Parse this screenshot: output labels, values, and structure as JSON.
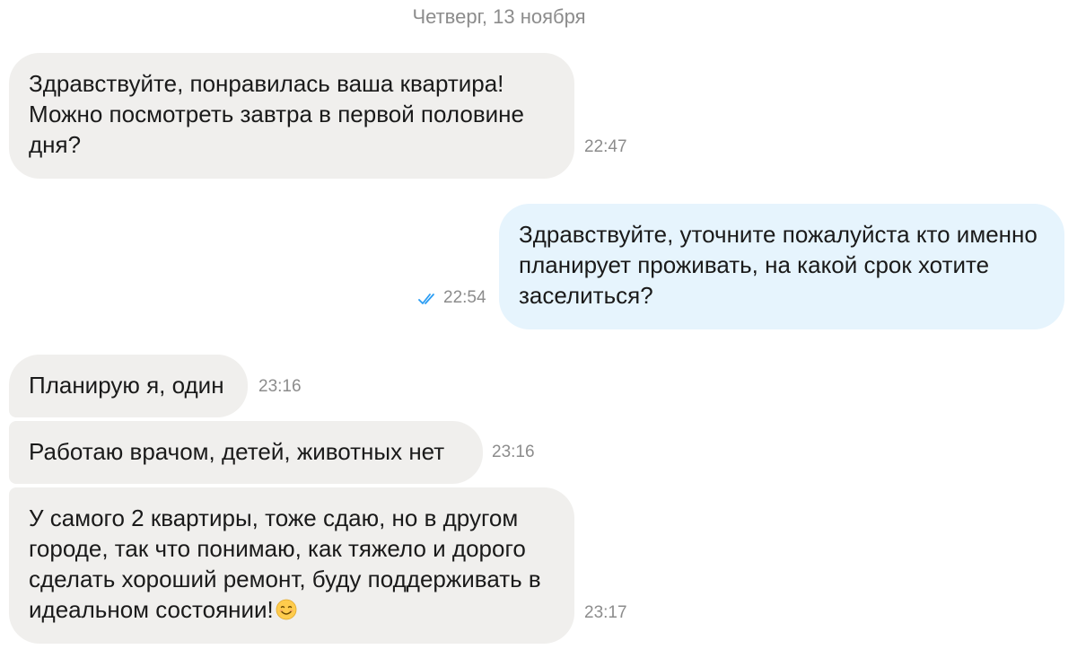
{
  "chat": {
    "date_header": "Четверг, 13 ноября",
    "messages": [
      {
        "direction": "incoming",
        "text": "Здравствуйте, понравилась ваша квартира! Можно посмотреть завтра в первой половине дня?",
        "time": "22:47"
      },
      {
        "direction": "outgoing",
        "text": "Здравствуйте, уточните пожалуйста кто именно планирует проживать, на какой срок хотите заселиться?",
        "time": "22:54",
        "status_icon": "double-check-icon",
        "status_color": "#2a9df4"
      },
      {
        "direction": "incoming",
        "text": "Планирую я, один",
        "time": "23:16"
      },
      {
        "direction": "incoming",
        "text": "Работаю врачом, детей, животных нет",
        "time": "23:16"
      },
      {
        "direction": "incoming",
        "text": "У самого 2 квартиры, тоже сдаю, но в другом городе, так что понимаю, как тяжело и дорого сделать хороший ремонт, буду поддерживать в идеальном состоянии!",
        "time": "23:17",
        "emoji": "smiling-face-icon"
      }
    ]
  },
  "colors": {
    "incoming_bubble": "#f0efed",
    "outgoing_bubble": "#e6f4fd",
    "meta_text": "#8c8c8c",
    "message_text": "#1a1a1a"
  }
}
